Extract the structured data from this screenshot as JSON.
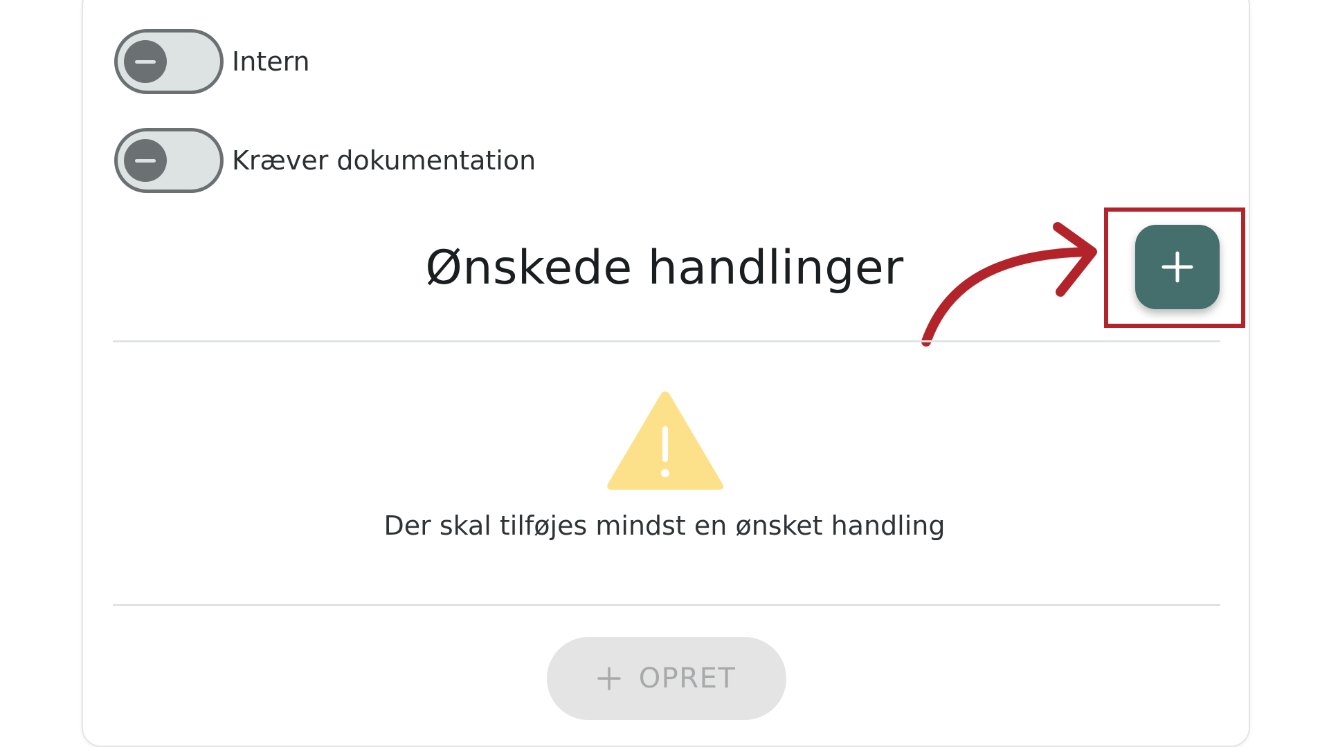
{
  "toggles": [
    {
      "label": "Intern",
      "state": "off"
    },
    {
      "label": "Kræver dokumentation",
      "state": "off"
    }
  ],
  "section": {
    "title": "Ønskede handlinger",
    "add_icon": "plus-icon"
  },
  "warning": {
    "icon": "warning-triangle-icon",
    "text": "Der skal tilføjes mindst en ønsket handling"
  },
  "create_button": {
    "icon": "plus-icon",
    "label": "OPRET",
    "state": "disabled"
  },
  "colors": {
    "fab": "#456f6d",
    "annotation": "#b3232a",
    "warning": "#fde08a",
    "toggle_off": "#6b7173",
    "disabled_button": "#e4e4e4"
  }
}
